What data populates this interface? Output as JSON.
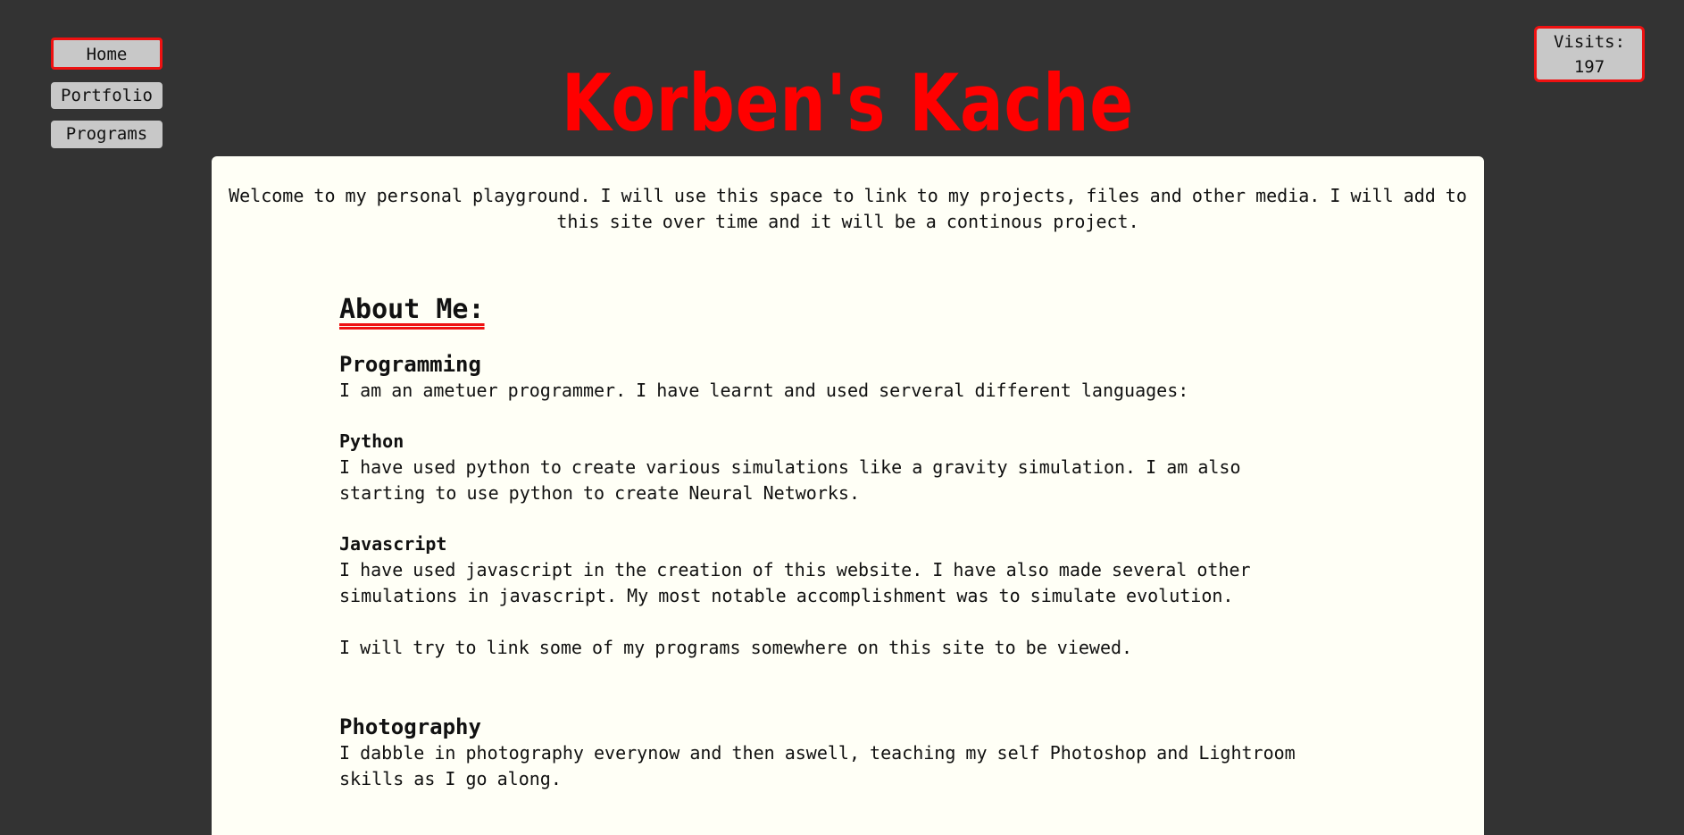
{
  "nav": {
    "home": "Home",
    "portfolio": "Portfolio",
    "programs": "Programs"
  },
  "visits": {
    "label": "Visits:",
    "count": "197"
  },
  "site_title": "Korben's Kache",
  "welcome": "Welcome to my personal playground. I will use this space to link to my projects, files and other media. I will add to this site over time and it will be a continous project.",
  "about": {
    "heading": "About Me:",
    "programming": {
      "heading": "Programming",
      "intro": "I am an ametuer programmer. I have learnt and used serveral different languages:",
      "python": {
        "heading": "Python",
        "text": "I have used python to create various simulations like a gravity simulation. I am also starting to use python to create Neural Networks."
      },
      "javascript": {
        "heading": "Javascript",
        "text": "I have used javascript in the creation of this website. I have also made several other simulations in javascript. My most notable accomplishment was to simulate evolution."
      },
      "outro": "I will try to link some of my programs somewhere on this site to be viewed."
    },
    "photography": {
      "heading": "Photography",
      "text": "I dabble in photography everynow and then aswell, teaching my self Photoshop and Lightroom skills as I go along."
    }
  },
  "colors": {
    "background": "#333333",
    "accent": "#ff0000",
    "panel": "#fffff6",
    "button": "#c8c8c8"
  }
}
